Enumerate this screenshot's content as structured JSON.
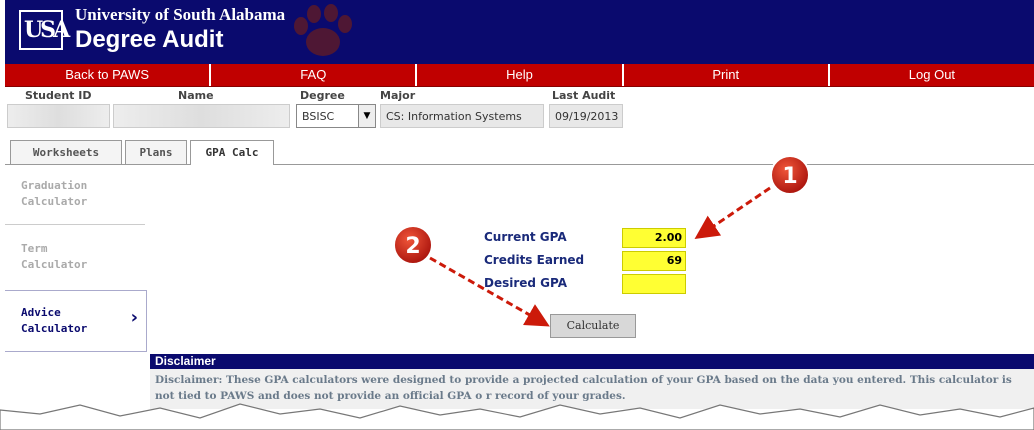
{
  "header": {
    "university": "University of South Alabama",
    "app_title": "Degree Audit",
    "logo_text": "USA"
  },
  "nav": [
    {
      "label": "Back to PAWS"
    },
    {
      "label": "FAQ"
    },
    {
      "label": "Help"
    },
    {
      "label": "Print"
    },
    {
      "label": "Log Out"
    }
  ],
  "student": {
    "id_label": "Student ID",
    "name_label": "Name",
    "degree_label": "Degree",
    "degree_value": "BSISC",
    "major_label": "Major",
    "major_value": "CS: Information Systems",
    "last_audit_label": "Last Audit",
    "last_audit_value": "09/19/2013"
  },
  "tabs": [
    {
      "label": "Worksheets"
    },
    {
      "label": "Plans"
    },
    {
      "label": "GPA Calc",
      "active": true
    }
  ],
  "sidebar": {
    "items": [
      {
        "line1": "Graduation",
        "line2": "Calculator"
      },
      {
        "line1": "Term",
        "line2": "Calculator"
      },
      {
        "line1": "Advice",
        "line2": "Calculator",
        "active": true
      }
    ]
  },
  "form": {
    "current_gpa_label": "Current GPA",
    "current_gpa_value": "2.00",
    "credits_label": "Credits Earned",
    "credits_value": "69",
    "desired_label": "Desired GPA",
    "desired_value": "",
    "calculate_label": "Calculate"
  },
  "disclaimer": {
    "title": "Disclaimer",
    "text": "Disclaimer: These GPA calculators were designed to provide a projected calculation of your GPA based on the data you entered. This calculator is not tied to PAWS and does not provide an official GPA o r record of your grades."
  },
  "callouts": [
    {
      "number": "1"
    },
    {
      "number": "2"
    }
  ],
  "colors": {
    "header_bg": "#0a0a6e",
    "nav_bg": "#c00000",
    "field_highlight": "#ffff33",
    "callout_red": "#cc1a0a"
  }
}
